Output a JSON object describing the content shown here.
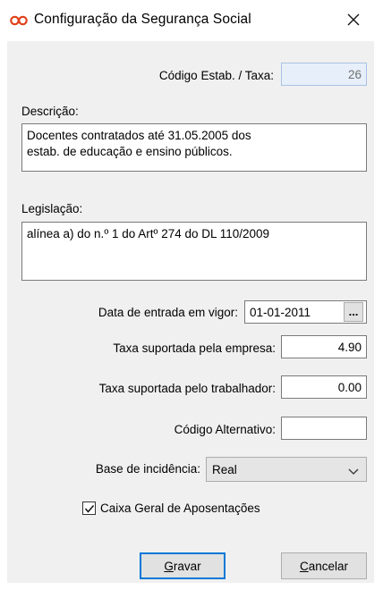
{
  "window": {
    "title": "Configuração da Segurança Social",
    "icon": "infinity-icon",
    "close_glyph": "✕",
    "accent": "#0078d7"
  },
  "form": {
    "code": {
      "label": "Código Estab. / Taxa:",
      "value": "26"
    },
    "description": {
      "label": "Descrição:",
      "line1": "Docentes contratados até 31.05.2005 dos",
      "line2": "estab. de educação e ensino públicos."
    },
    "legislation": {
      "label": "Legislação:",
      "value": "alínea a) do n.º 1 do Artº 274 do DL 110/2009"
    },
    "start_date": {
      "label": "Data de entrada em vigor:",
      "value": "01-01-2011",
      "button": "..."
    },
    "employer_rate": {
      "label": "Taxa suportada pela empresa:",
      "value": "4.90"
    },
    "worker_rate": {
      "label": "Taxa suportada pelo trabalhador:",
      "value": "0.00"
    },
    "alt_code": {
      "label": "Código Alternativo:",
      "value": ""
    },
    "base": {
      "label": "Base de incidência:",
      "selected": "Real"
    },
    "cga": {
      "label": "Caixa Geral de Aposentações",
      "checked": true
    }
  },
  "buttons": {
    "save_first": "G",
    "save_rest": "ravar",
    "cancel_first": "C",
    "cancel_rest": "ancelar"
  }
}
